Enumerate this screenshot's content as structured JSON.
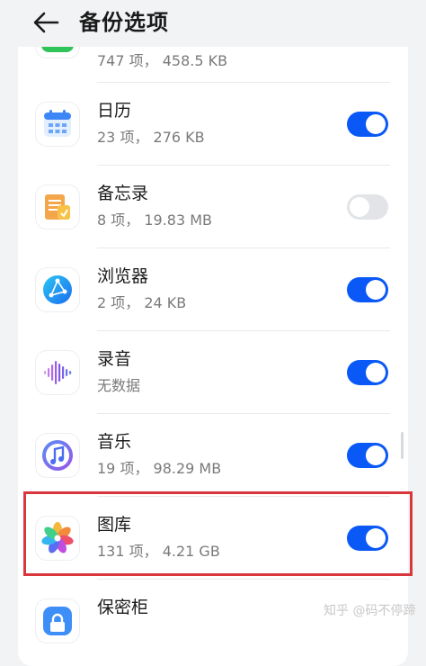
{
  "header": {
    "title": "备份选项",
    "back_icon": "arrow-left-icon"
  },
  "partial_item": {
    "detail": "747 项， 458.5 KB",
    "icon": "phone-green-icon"
  },
  "items": [
    {
      "name": "日历",
      "detail": "23 项， 276 KB",
      "icon": "calendar-icon",
      "enabled": true
    },
    {
      "name": "备忘录",
      "detail": "8 项， 19.83 MB",
      "icon": "notepad-icon",
      "enabled": false
    },
    {
      "name": "浏览器",
      "detail": "2 项， 24 KB",
      "icon": "browser-globe-icon",
      "enabled": true
    },
    {
      "name": "录音",
      "detail": "无数据",
      "icon": "sound-recorder-icon",
      "enabled": true
    },
    {
      "name": "音乐",
      "detail": "19 项， 98.29 MB",
      "icon": "music-note-icon",
      "enabled": true
    },
    {
      "name": "图库",
      "detail": "131 项， 4.21 GB",
      "icon": "gallery-flower-icon",
      "enabled": true
    },
    {
      "name": "保密柜",
      "detail": "",
      "icon": "safe-lock-icon",
      "enabled": true
    }
  ],
  "watermark": "知乎 @码不停蹄",
  "colors": {
    "toggle_on": "#0a59f7",
    "toggle_off": "#e2e4e7",
    "highlight_border": "#d9363e",
    "background": "#f1f3f5"
  }
}
